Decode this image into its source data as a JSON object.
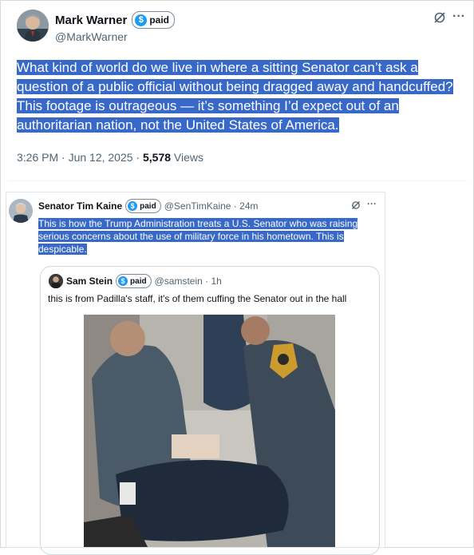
{
  "tweet": {
    "author_name": "Mark Warner",
    "badge_label": "paid",
    "handle": "@MarkWarner",
    "text": "What kind of world do we live in where a sitting Senator can’t ask a question of a public official without being dragged away and handcuffed? This footage is outrageous — it’s something I’d expect out of an authoritarian nation, not the United States of America.",
    "time": "3:26 PM · Jun 12, 2025 · ",
    "views_count": "5,578",
    "views_label": " Views",
    "more_glyph": "···"
  },
  "embedded": {
    "author_name": "Senator Tim Kaine",
    "badge_label": "paid",
    "handle_time": "@SenTimKaine · 24m",
    "text": "This is how the Trump Administration treats a U.S. Senator who was raising serious concerns about the use of military force in his hometown. This is despicable.",
    "more_glyph": "···",
    "quote": {
      "author_name": "Sam Stein",
      "badge_label": "paid",
      "handle_time": "@samstein · 1h",
      "text": "this is from Padilla's staff, it's of them cuffing the Senator out in the hall"
    }
  },
  "icons": {
    "dollar_glyph": "$"
  },
  "colors": {
    "selection": "#3869c9",
    "verified_blue": "#1d9bf0",
    "muted_text": "#536471"
  }
}
